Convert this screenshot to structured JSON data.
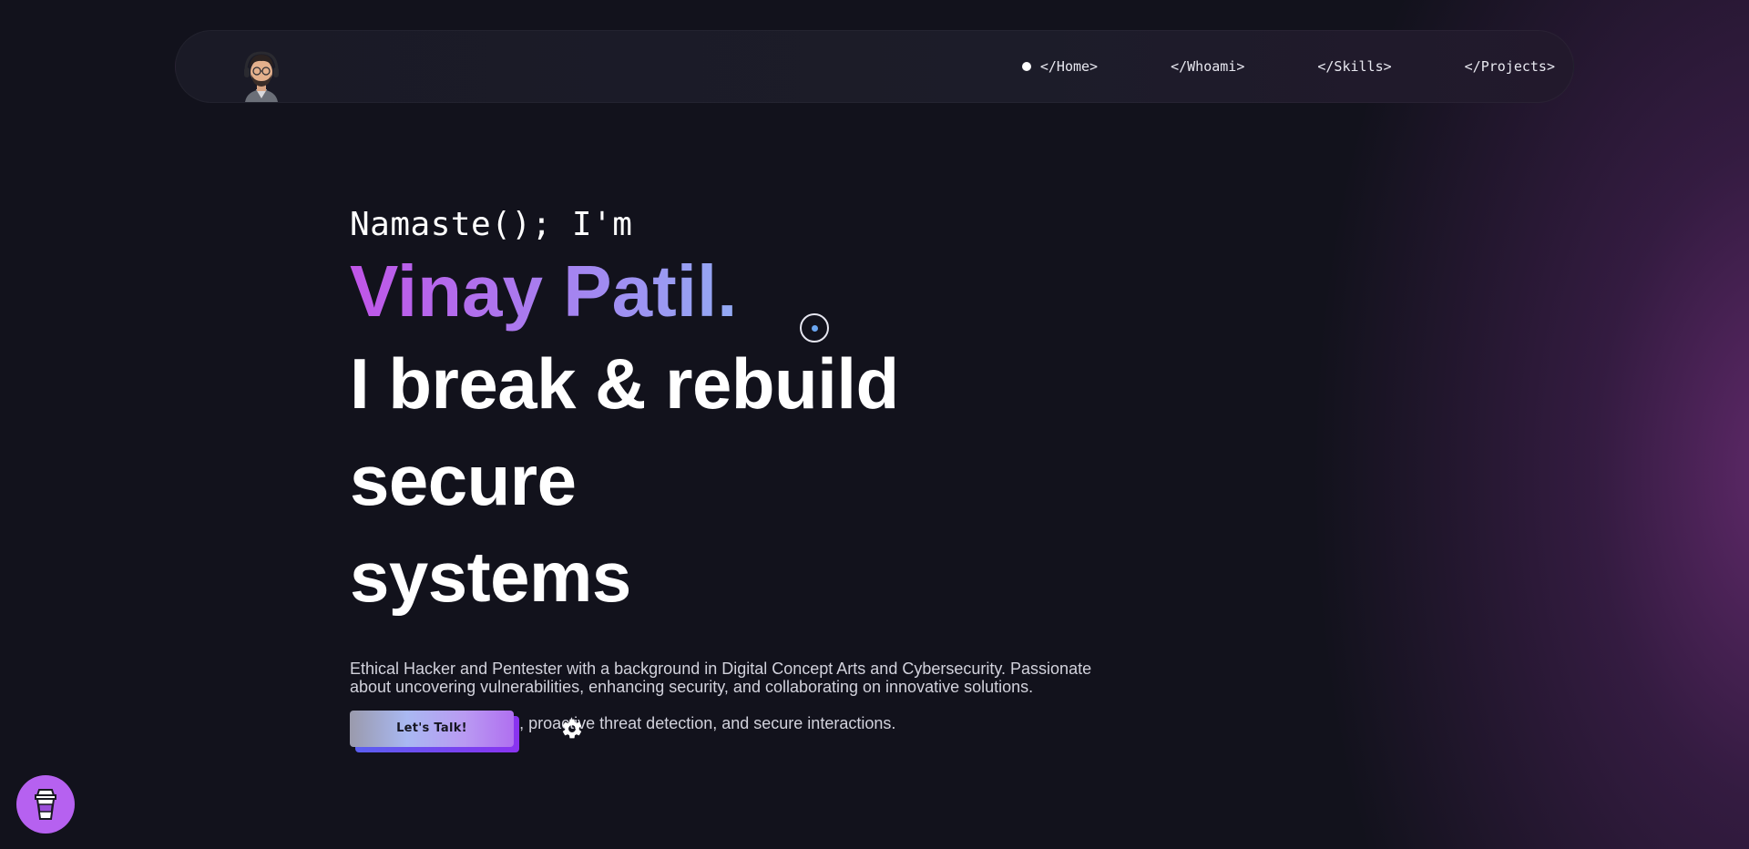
{
  "nav": {
    "avatar_icon": "avatar-icon",
    "links": [
      {
        "label": "</Home>",
        "active": true
      },
      {
        "label": "</Whoami>",
        "active": false
      },
      {
        "label": "</Skills>",
        "active": false
      },
      {
        "label": "</Projects>",
        "active": false
      }
    ]
  },
  "hero": {
    "greeting": "Namaste(); I'm",
    "name": "Vinay Patil.",
    "headline_line1": "I break & rebuild secure",
    "headline_line2": "systems",
    "bio_paragraph1": "Ethical Hacker and Pentester with a background in Digital Concept Arts and Cybersecurity. Passionate about uncovering vulnerabilities, enhancing security, and collaborating on innovative solutions.",
    "bio_paragraph2": "I value robust defenses, proactive threat detection, and secure interactions."
  },
  "actions": {
    "talk_label": "Let's Talk!",
    "settings_icon": "gear-icon"
  },
  "fab": {
    "icon": "coffee-cup-icon"
  },
  "colors": {
    "background": "#12121c",
    "accent_purple": "#c055e8",
    "accent_blue": "#93aaf4",
    "fab": "#b661f0"
  }
}
